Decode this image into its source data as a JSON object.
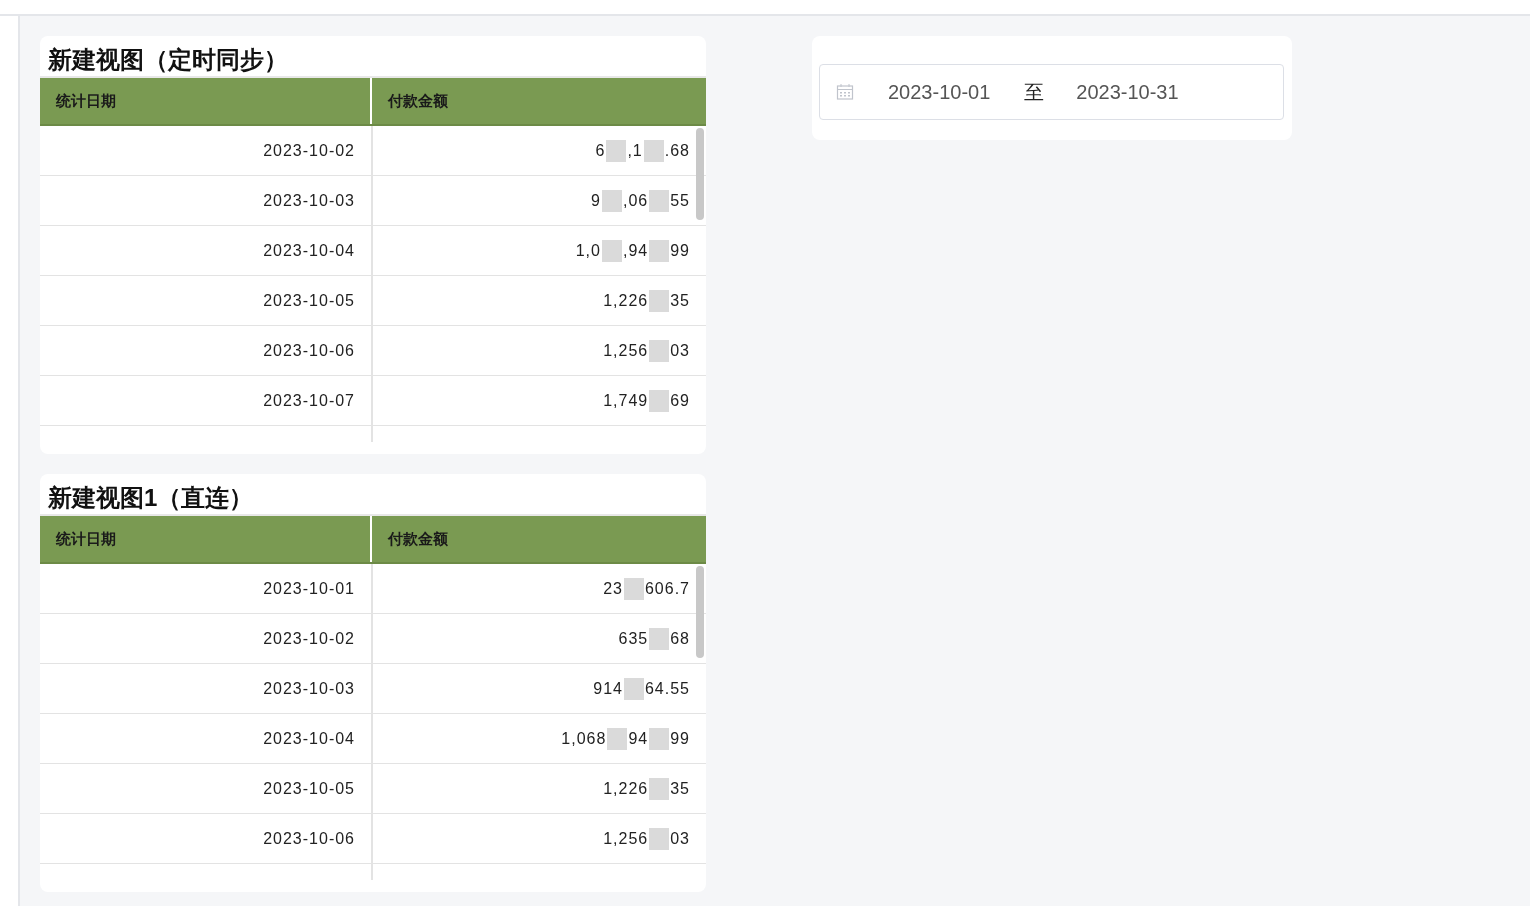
{
  "views": [
    {
      "title": "新建视图（定时同步）",
      "columns": [
        "统计日期",
        "付款金额"
      ],
      "rows": [
        {
          "date": "2023-10-02",
          "amount_parts": [
            "6",
            ",1",
            ".68"
          ]
        },
        {
          "date": "2023-10-03",
          "amount_parts": [
            "9",
            ",06",
            "55"
          ]
        },
        {
          "date": "2023-10-04",
          "amount_parts": [
            "1,0",
            ",94",
            "99"
          ]
        },
        {
          "date": "2023-10-05",
          "amount_parts": [
            "1,226",
            "35"
          ]
        },
        {
          "date": "2023-10-06",
          "amount_parts": [
            "1,256",
            "03"
          ]
        },
        {
          "date": "2023-10-07",
          "amount_parts": [
            "1,749",
            "69"
          ]
        }
      ]
    },
    {
      "title": "新建视图1（直连）",
      "columns": [
        "统计日期",
        "付款金额"
      ],
      "rows": [
        {
          "date": "2023-10-01",
          "amount_parts": [
            "23",
            "606.7"
          ]
        },
        {
          "date": "2023-10-02",
          "amount_parts": [
            "635",
            "68"
          ]
        },
        {
          "date": "2023-10-03",
          "amount_parts": [
            "914",
            "64.55"
          ]
        },
        {
          "date": "2023-10-04",
          "amount_parts": [
            "1,068",
            "94",
            "99"
          ]
        },
        {
          "date": "2023-10-05",
          "amount_parts": [
            "1,226",
            "35"
          ]
        },
        {
          "date": "2023-10-06",
          "amount_parts": [
            "1,256",
            "03"
          ]
        }
      ]
    }
  ],
  "date_range": {
    "start": "2023-10-01",
    "separator": "至",
    "end": "2023-10-31"
  }
}
